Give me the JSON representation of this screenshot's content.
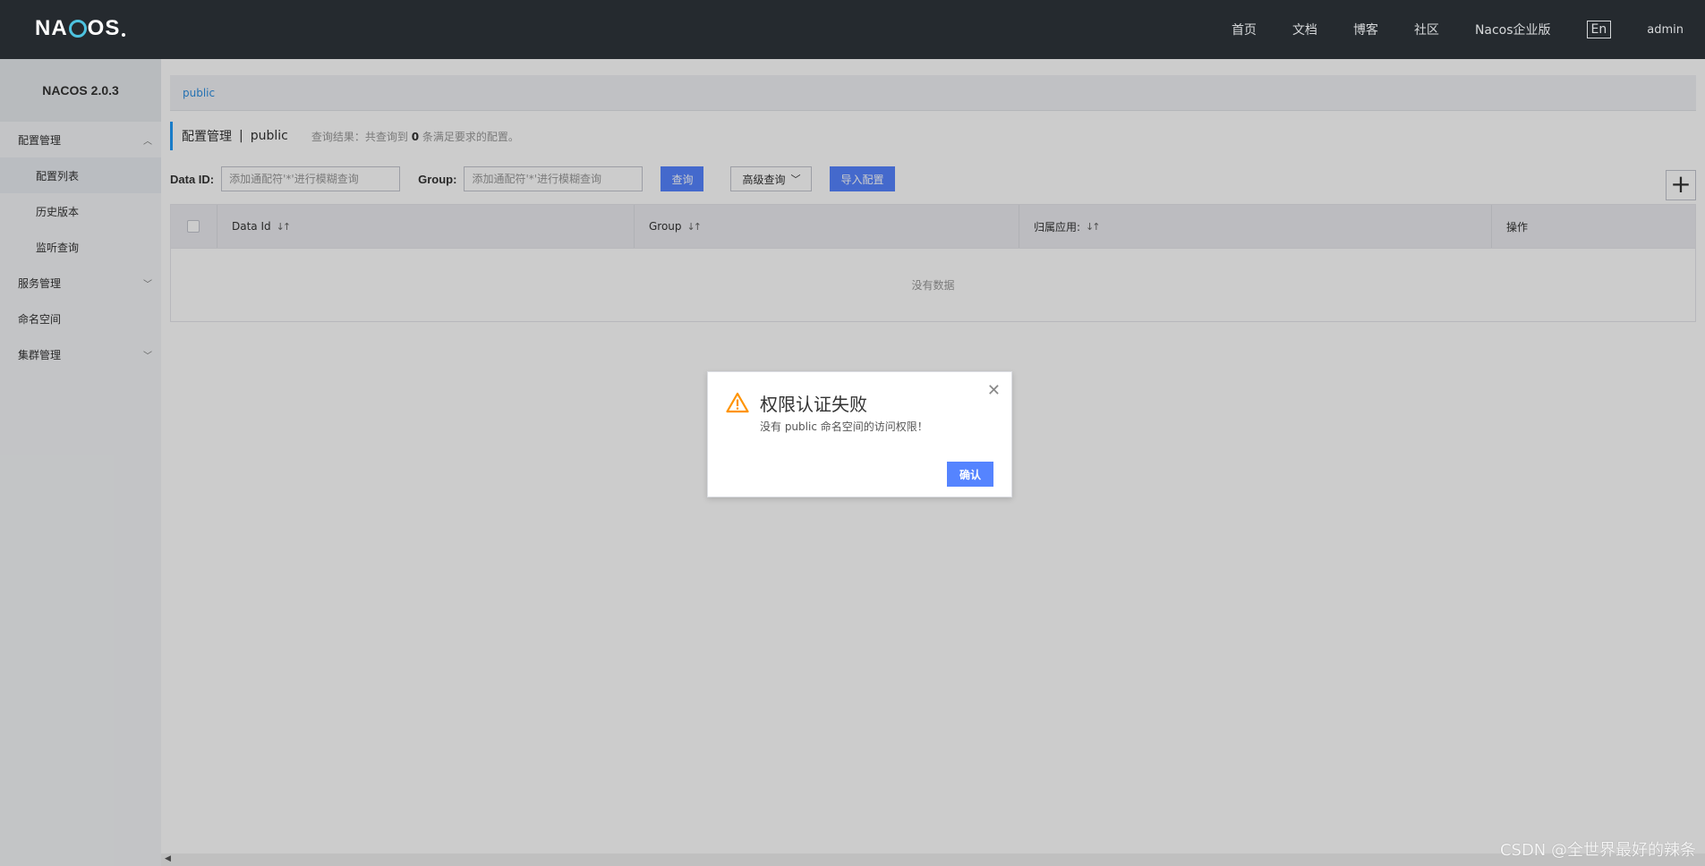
{
  "header": {
    "logo": "NACOS",
    "nav": [
      "首页",
      "文档",
      "博客",
      "社区",
      "Nacos企业版"
    ],
    "lang": "En",
    "user": "admin"
  },
  "sidebar": {
    "version": "NACOS 2.0.3",
    "groups": [
      {
        "label": "配置管理",
        "items": [
          "配置列表",
          "历史版本",
          "监听查询"
        ]
      },
      {
        "label": "服务管理"
      },
      {
        "label": "命名空间"
      },
      {
        "label": "集群管理"
      }
    ]
  },
  "main": {
    "namespace_tab": "public",
    "title": "配置管理",
    "title_sep": "|",
    "namespace": "public",
    "result_prefix": "查询结果：共查询到",
    "result_count": "0",
    "result_suffix": "条满足要求的配置。",
    "filter": {
      "data_id_label": "Data ID:",
      "data_id_placeholder": "添加通配符'*'进行模糊查询",
      "group_label": "Group:",
      "group_placeholder": "添加通配符'*'进行模糊查询",
      "query_button": "查询",
      "advanced_button": "高级查询",
      "import_button": "导入配置"
    },
    "table": {
      "columns": [
        "Data Id",
        "Group",
        "归属应用:",
        "操作"
      ],
      "empty": "没有数据"
    }
  },
  "dialog": {
    "title": "权限认证失败",
    "message": "没有 public 命名空间的访问权限！",
    "ok": "确认"
  },
  "watermark": "CSDN @全世界最好的辣条",
  "colors": {
    "primary": "#5584ff",
    "header_bg": "#252a2f",
    "warning": "#ff9300"
  }
}
